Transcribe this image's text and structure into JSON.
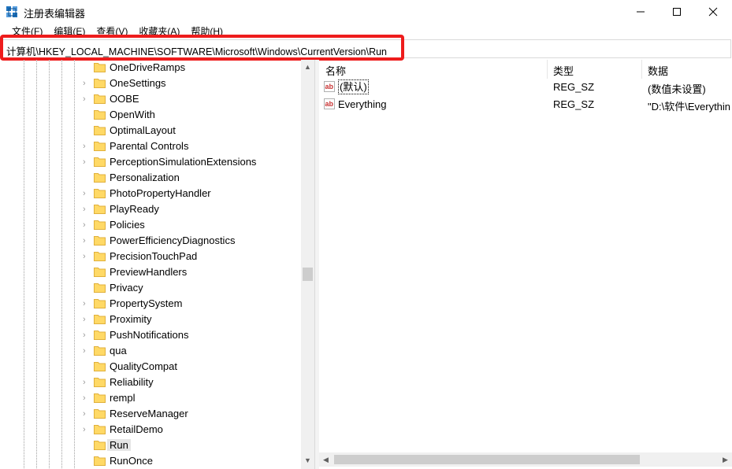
{
  "window": {
    "title": "注册表编辑器",
    "minimize_label": "—",
    "maximize_label": "☐",
    "close_label": "✕"
  },
  "menu": [
    "文件(F)",
    "编辑(E)",
    "查看(V)",
    "收藏夹(A)",
    "帮助(H)"
  ],
  "address": {
    "path": "计算机\\HKEY_LOCAL_MACHINE\\SOFTWARE\\Microsoft\\Windows\\CurrentVersion\\Run"
  },
  "tree": {
    "items": [
      {
        "label": "OneDriveRamps",
        "expandable": false
      },
      {
        "label": "OneSettings",
        "expandable": true
      },
      {
        "label": "OOBE",
        "expandable": true
      },
      {
        "label": "OpenWith",
        "expandable": false
      },
      {
        "label": "OptimalLayout",
        "expandable": false
      },
      {
        "label": "Parental Controls",
        "expandable": true
      },
      {
        "label": "PerceptionSimulationExtensions",
        "expandable": true
      },
      {
        "label": "Personalization",
        "expandable": false
      },
      {
        "label": "PhotoPropertyHandler",
        "expandable": true
      },
      {
        "label": "PlayReady",
        "expandable": true
      },
      {
        "label": "Policies",
        "expandable": true
      },
      {
        "label": "PowerEfficiencyDiagnostics",
        "expandable": true
      },
      {
        "label": "PrecisionTouchPad",
        "expandable": true
      },
      {
        "label": "PreviewHandlers",
        "expandable": false
      },
      {
        "label": "Privacy",
        "expandable": false
      },
      {
        "label": "PropertySystem",
        "expandable": true
      },
      {
        "label": "Proximity",
        "expandable": true
      },
      {
        "label": "PushNotifications",
        "expandable": true
      },
      {
        "label": "qua",
        "expandable": true
      },
      {
        "label": "QualityCompat",
        "expandable": false
      },
      {
        "label": "Reliability",
        "expandable": true
      },
      {
        "label": "rempl",
        "expandable": true
      },
      {
        "label": "ReserveManager",
        "expandable": true
      },
      {
        "label": "RetailDemo",
        "expandable": true
      },
      {
        "label": "Run",
        "expandable": false,
        "selected": true
      },
      {
        "label": "RunOnce",
        "expandable": false
      }
    ]
  },
  "list": {
    "columns": {
      "name": "名称",
      "type": "类型",
      "data": "数据"
    },
    "rows": [
      {
        "icon": "ab-string-icon",
        "name": "(默认)",
        "type": "REG_SZ",
        "data": "(数值未设置)"
      },
      {
        "icon": "ab-string-icon",
        "name": "Everything",
        "type": "REG_SZ",
        "data": "\"D:\\软件\\Everythin"
      }
    ]
  },
  "colors": {
    "highlight_border": "#ee1c1c",
    "folder_fill": "#ffd966",
    "folder_edge": "#e0b03c",
    "icon_red": "#c83232"
  }
}
